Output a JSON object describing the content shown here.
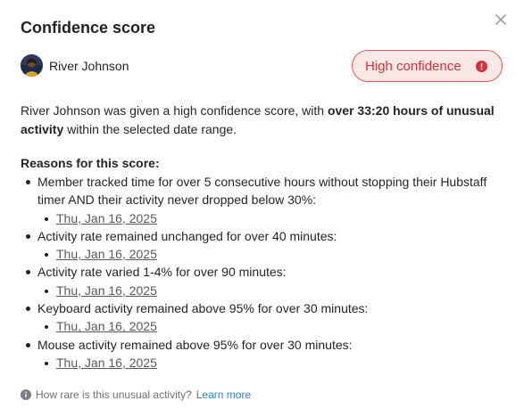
{
  "dialog": {
    "title": "Confidence score",
    "close_icon": "close-icon"
  },
  "member": {
    "name": "River Johnson",
    "avatar_icon": "avatar"
  },
  "badge": {
    "label": "High confidence",
    "icon": "info-icon",
    "colors": {
      "background": "#fde8e8",
      "border": "#e25b5b",
      "text": "#d1333a"
    }
  },
  "summary": {
    "part1": "River Johnson was given a high confidence score, with ",
    "bold": "over 33:20 hours of unusual activity",
    "part2": " within the selected date range."
  },
  "reasons": {
    "title": "Reasons for this score:",
    "items": [
      {
        "text": "Member tracked time for over 5 consecutive hours without stopping their Hubstaff timer AND their activity never dropped below 30%:",
        "dates": [
          "Thu, Jan 16, 2025"
        ]
      },
      {
        "text": "Activity rate remained unchanged for over 40 minutes:",
        "dates": [
          "Thu, Jan 16, 2025"
        ]
      },
      {
        "text": "Activity rate varied 1-4% for over 90 minutes:",
        "dates": [
          "Thu, Jan 16, 2025"
        ]
      },
      {
        "text": "Keyboard activity remained above 95% for over 30 minutes:",
        "dates": [
          "Thu, Jan 16, 2025"
        ]
      },
      {
        "text": "Mouse activity remained above 95% for over 30 minutes:",
        "dates": [
          "Thu, Jan 16, 2025"
        ]
      }
    ]
  },
  "footer": {
    "question": "How rare is this unusual activity?",
    "link": "Learn more",
    "icon": "info-icon"
  }
}
